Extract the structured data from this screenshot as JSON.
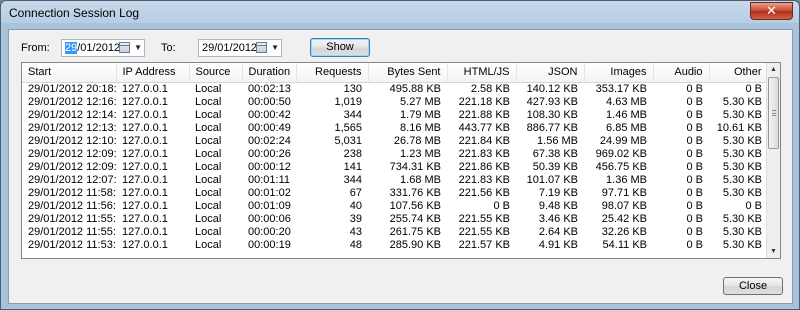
{
  "window": {
    "title": "Connection Session Log",
    "close_glyph": "✕"
  },
  "filter": {
    "from_label": "From:",
    "from_date_selected": "29",
    "from_date_rest": "/01/2012",
    "to_label": "To:",
    "to_date": "29/01/2012",
    "show_label": "Show"
  },
  "table": {
    "columns": [
      "Start",
      "IP Address",
      "Source",
      "Duration",
      "Requests",
      "Bytes Sent",
      "HTML/JS",
      "JSON",
      "Images",
      "Audio",
      "Other"
    ],
    "rows": [
      [
        "29/01/2012 20:18:24",
        "127.0.0.1",
        "Local",
        "00:02:13",
        "130",
        "495.88 KB",
        "2.58 KB",
        "140.12 KB",
        "353.17 KB",
        "0 B",
        "0 B"
      ],
      [
        "29/01/2012 12:16:53",
        "127.0.0.1",
        "Local",
        "00:00:50",
        "1,019",
        "5.27 MB",
        "221.18 KB",
        "427.93 KB",
        "4.63 MB",
        "0 B",
        "5.30 KB"
      ],
      [
        "29/01/2012 12:14:48",
        "127.0.0.1",
        "Local",
        "00:00:42",
        "344",
        "1.79 MB",
        "221.88 KB",
        "108.30 KB",
        "1.46 MB",
        "0 B",
        "5.30 KB"
      ],
      [
        "29/01/2012 12:13:39",
        "127.0.0.1",
        "Local",
        "00:00:49",
        "1,565",
        "8.16 MB",
        "443.77 KB",
        "886.77 KB",
        "6.85 MB",
        "0 B",
        "10.61 KB"
      ],
      [
        "29/01/2012 12:10:53",
        "127.0.0.1",
        "Local",
        "00:02:24",
        "5,031",
        "26.78 MB",
        "221.84 KB",
        "1.56 MB",
        "24.99 MB",
        "0 B",
        "5.30 KB"
      ],
      [
        "29/01/2012 12:09:49",
        "127.0.0.1",
        "Local",
        "00:00:26",
        "238",
        "1.23 MB",
        "221.83 KB",
        "67.38 KB",
        "969.02 KB",
        "0 B",
        "5.30 KB"
      ],
      [
        "29/01/2012 12:09:01",
        "127.0.0.1",
        "Local",
        "00:00:12",
        "141",
        "734.31 KB",
        "221.86 KB",
        "50.39 KB",
        "456.75 KB",
        "0 B",
        "5.30 KB"
      ],
      [
        "29/01/2012 12:07:13",
        "127.0.0.1",
        "Local",
        "00:01:11",
        "344",
        "1.68 MB",
        "221.83 KB",
        "101.07 KB",
        "1.36 MB",
        "0 B",
        "5.30 KB"
      ],
      [
        "29/01/2012 11:58:05",
        "127.0.0.1",
        "Local",
        "00:01:02",
        "67",
        "331.76 KB",
        "221.56 KB",
        "7.19 KB",
        "97.71 KB",
        "0 B",
        "5.30 KB"
      ],
      [
        "29/01/2012 11:56:21",
        "127.0.0.1",
        "Local",
        "00:01:09",
        "40",
        "107.56 KB",
        "0 B",
        "9.48 KB",
        "98.07 KB",
        "0 B",
        "0 B"
      ],
      [
        "29/01/2012 11:55:53",
        "127.0.0.1",
        "Local",
        "00:00:06",
        "39",
        "255.74 KB",
        "221.55 KB",
        "3.46 KB",
        "25.42 KB",
        "0 B",
        "5.30 KB"
      ],
      [
        "29/01/2012 11:55:12",
        "127.0.0.1",
        "Local",
        "00:00:20",
        "43",
        "261.75 KB",
        "221.55 KB",
        "2.64 KB",
        "32.26 KB",
        "0 B",
        "5.30 KB"
      ],
      [
        "29/01/2012 11:53:46",
        "127.0.0.1",
        "Local",
        "00:00:19",
        "48",
        "285.90 KB",
        "221.57 KB",
        "4.91 KB",
        "54.11 KB",
        "0 B",
        "5.30 KB"
      ]
    ]
  },
  "footer": {
    "close_label": "Close"
  },
  "colors": {
    "selection": "#3399ff",
    "close_button": "#c7452d"
  }
}
